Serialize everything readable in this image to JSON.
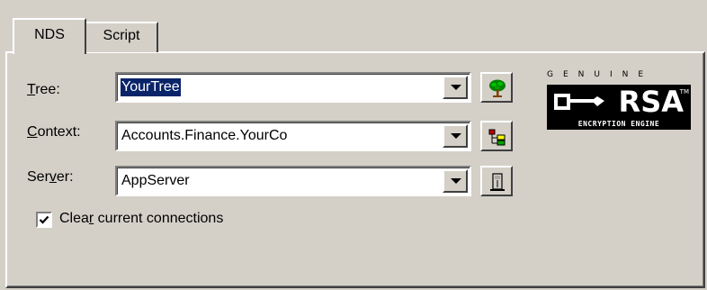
{
  "tabs": [
    {
      "label": "NDS",
      "active": true
    },
    {
      "label": "Script",
      "active": false
    }
  ],
  "fields": {
    "tree": {
      "label_prefix": "",
      "label_mnemonic": "T",
      "label_rest": "ree:",
      "value": "YourTree",
      "selected": true
    },
    "context": {
      "label_prefix": "",
      "label_mnemonic": "C",
      "label_rest": "ontext:",
      "value": "Accounts.Finance.YourCo"
    },
    "server": {
      "label_prefix": "Ser",
      "label_mnemonic": "v",
      "label_rest": "er:",
      "value": "AppServer"
    }
  },
  "buttons": {
    "tree_browse_icon": "tree-icon",
    "context_browse_icon": "hierarchy-icon",
    "server_browse_icon": "server-icon"
  },
  "checkbox": {
    "checked": true,
    "label_prefix": "Clea",
    "label_mnemonic": "r",
    "label_rest": " current connections"
  },
  "logo": {
    "top_text": "GENUINE",
    "main_text": "RSA",
    "tm": "TM",
    "bottom_text": "ENCRYPTION ENGINE"
  },
  "colors": {
    "face": "#d4d0c8",
    "selection": "#0a246a"
  }
}
